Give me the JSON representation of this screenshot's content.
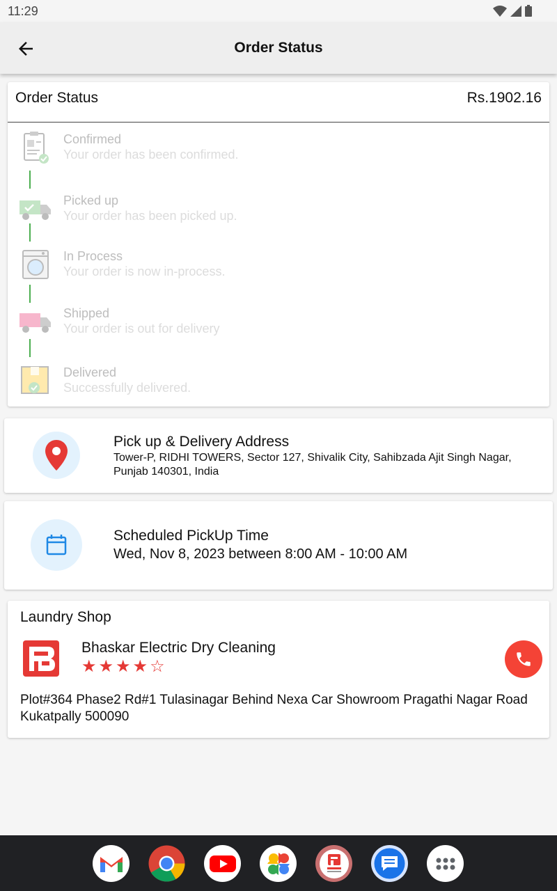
{
  "status_bar": {
    "time": "11:29"
  },
  "app_bar": {
    "title": "Order Status"
  },
  "order": {
    "label": "Order Status",
    "amount": "Rs.1902.16",
    "steps": [
      {
        "title": "Confirmed",
        "desc": "Your order has been confirmed.",
        "icon": "clipboard-check-icon"
      },
      {
        "title": "Picked up",
        "desc": "Your order has been picked up.",
        "icon": "pickup-truck-icon"
      },
      {
        "title": "In Process",
        "desc": "Your order is now in-process.",
        "icon": "washing-machine-icon"
      },
      {
        "title": "Shipped",
        "desc": "Your order is out for delivery",
        "icon": "delivery-truck-icon"
      },
      {
        "title": "Delivered",
        "desc": "Successfully delivered.",
        "icon": "package-check-icon"
      }
    ],
    "connector_color": "#4caf50"
  },
  "address": {
    "title": "Pick up & Delivery Address",
    "text": "Tower-P, RIDHI TOWERS, Sector 127, Shivalik City, Sahibzada Ajit Singh Nagar, Punjab 140301, India",
    "icon": "location-pin-icon"
  },
  "schedule": {
    "title": "Scheduled PickUp Time",
    "text": "Wed, Nov 8, 2023 between 8:00 AM - 10:00 AM",
    "icon": "calendar-icon"
  },
  "shop": {
    "section_title": "Laundry Shop",
    "name": "Bhaskar Electric Dry Cleaning",
    "rating": 4,
    "rating_max": 5,
    "address": "Plot#364 Phase2 Rd#1 Tulasinagar Behind Nexa Car Showroom Pragathi Nagar Road Kukatpally 500090",
    "accent": "#f44336"
  },
  "dock_apps": [
    "gmail-icon",
    "chrome-icon",
    "youtube-icon",
    "photos-icon",
    "laundry-app-icon",
    "messages-icon",
    "app-drawer-icon"
  ]
}
